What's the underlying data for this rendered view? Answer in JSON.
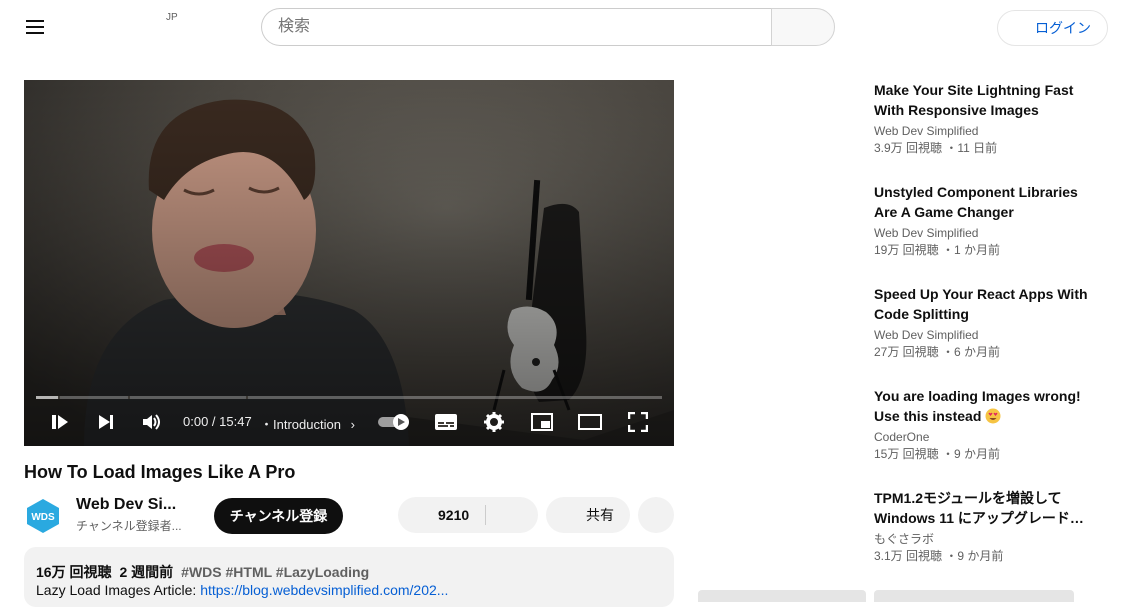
{
  "header": {
    "country_code": "JP",
    "search_placeholder": "検索",
    "login_label": "ログイン"
  },
  "player": {
    "current_time": "0:00 / 15:47",
    "chapter": "・Introduction",
    "progress_fraction": 0,
    "chapter_dividers": [
      "at start",
      "Introduction",
      "part 2"
    ],
    "icons": [
      "play-pause-icon",
      "next-icon",
      "volume-icon",
      "autoplay-toggle-icon",
      "subtitles-icon",
      "settings-icon",
      "miniplayer-icon",
      "theater-icon",
      "fullscreen-icon"
    ]
  },
  "video": {
    "title": "How To Load Images Like A Pro",
    "channel_name": "Web Dev Si...",
    "channel_logo_text": "WDS",
    "subscribers": "チャンネル登録者...",
    "subscribe_label": "チャンネル登録",
    "like_count": "9210",
    "share_label": "共有",
    "views": "16万 回視聴",
    "age": "2 週間前",
    "tags": "#WDS #HTML #LazyLoading",
    "desc_prefix": "Lazy Load Images Article: ",
    "desc_link": "https://blog.webdevsimplified.com/202..."
  },
  "recommendations": [
    {
      "title": "Make Your Site Lightning Fast With Responsive Images",
      "channel": "Web Dev Simplified",
      "meta": "3.9万 回視聴 ・11 日前"
    },
    {
      "title": "Unstyled Component Libraries Are A Game Changer",
      "channel": "Web Dev Simplified",
      "meta": "19万 回視聴 ・1 か月前"
    },
    {
      "title": "Speed Up Your React Apps With Code Splitting",
      "channel": "Web Dev Simplified",
      "meta": "27万 回視聴 ・6 か月前"
    },
    {
      "title": "You are loading Images wrong! Use this instead",
      "channel": "CoderOne",
      "meta": "15万 回視聴 ・9 か月前",
      "emoji": "heart-eyes-emoji"
    },
    {
      "title": "TPM1.2モジュールを増設して Windows 11 にアップグレード…",
      "channel": "もぐさラボ",
      "meta": "3.1万 回視聴 ・9 か月前"
    }
  ],
  "colors": {
    "link": "#065fd4",
    "subscribe_bg": "#0f0f0f",
    "pill_bg": "#f2f2f2",
    "secondary_text": "#606060"
  }
}
